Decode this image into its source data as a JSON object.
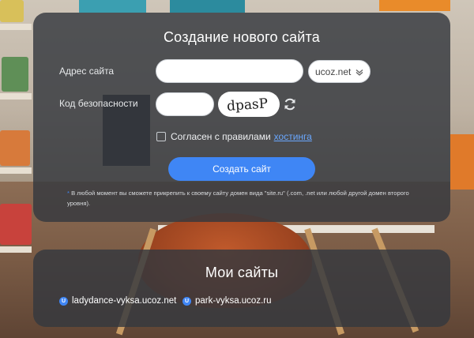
{
  "create_site": {
    "title": "Создание нового сайта",
    "address_label": "Адрес сайта",
    "address_value": "",
    "domain_selected": "ucoz.net",
    "security_label": "Код безопасности",
    "captcha_value": "",
    "captcha_text": "dpasP",
    "agree_text": "Согласен с правилами",
    "agree_link": "хостинга",
    "agree_checked": false,
    "create_button": "Создать сайт",
    "note_star": "*",
    "note_text": "В любой момент вы сможете прикрепить к своему сайту домен вида \"site.ru\" (.com, .net или любой другой домен второго уровня)."
  },
  "my_sites": {
    "title": "Мои сайты",
    "sites": [
      {
        "badge": "U",
        "name": "ladydance-vyksa.ucoz.net"
      },
      {
        "badge": "U",
        "name": "park-vyksa.ucoz.ru"
      }
    ]
  },
  "colors": {
    "accent": "#3f86f5",
    "panel": "#34383e",
    "link": "#6aa8ff"
  },
  "icons": {
    "domain_select": "chevron-down-icon",
    "captcha_refresh": "refresh-icon",
    "site_badge": "ucoz-u-icon"
  }
}
